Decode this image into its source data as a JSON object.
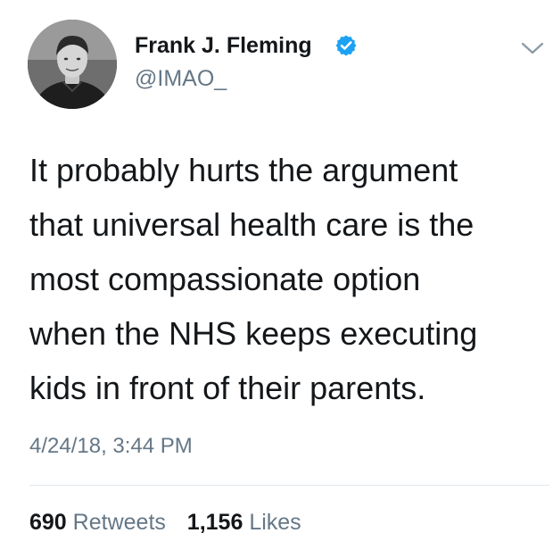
{
  "author": {
    "name": "Frank J. Fleming",
    "handle": "@IMAO_",
    "verified": true
  },
  "tweet": {
    "lines": [
      "It probably hurts the argument",
      "that universal health care is the",
      "most compassionate option",
      "when the NHS keeps executing",
      "kids in front of their parents."
    ],
    "timestamp": "4/24/18, 3:44 PM"
  },
  "stats": {
    "retweets_count": "690",
    "retweets_label": "Retweets",
    "likes_count": "1,156",
    "likes_label": "Likes"
  },
  "icons": {
    "verified": "verified-badge-icon",
    "menu": "chevron-down-icon"
  },
  "colors": {
    "primary_text": "#14171a",
    "secondary_text": "#657786",
    "verified_badge": "#1da1f2",
    "divider": "#e1e8ed"
  }
}
